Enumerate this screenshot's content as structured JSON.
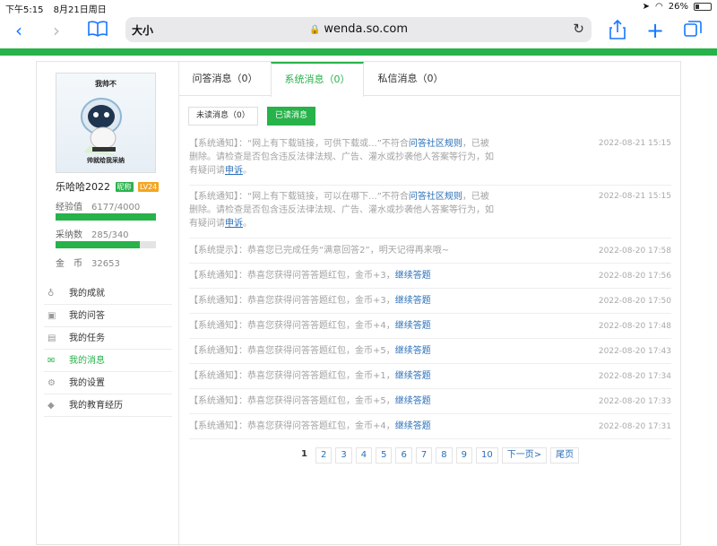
{
  "status_bar": {
    "time": "下午5:15",
    "date": "8月21日周日",
    "battery": "26%",
    "battery_level": 0.26
  },
  "browser": {
    "text_size": "大小",
    "url": "wenda.so.com"
  },
  "profile": {
    "avatar_top_text": "我帅不",
    "avatar_bottom_text": "帅就给我采纳",
    "username": "乐哈哈2022",
    "badge_nick": "昵称",
    "badge_level": "LV24",
    "experience_label": "经验值",
    "experience_value": "6177/4000",
    "experience_fill": 1.0,
    "adoption_label": "采纳数",
    "adoption_value": "285/340",
    "adoption_fill": 0.838,
    "coins_label": "金　币",
    "coins_value": "32653"
  },
  "menu": [
    {
      "label": "我的成就",
      "icon": "medal-icon",
      "active": false
    },
    {
      "label": "我的问答",
      "icon": "question-icon",
      "active": false
    },
    {
      "label": "我的任务",
      "icon": "calendar-icon",
      "active": false
    },
    {
      "label": "我的消息",
      "icon": "mail-icon",
      "active": true
    },
    {
      "label": "我的设置",
      "icon": "gear-icon",
      "active": false
    },
    {
      "label": "我的教育经历",
      "icon": "graduation-cap-icon",
      "active": false
    }
  ],
  "tabs": [
    {
      "label": "问答消息（0）",
      "active": false
    },
    {
      "label": "系统消息（0）",
      "active": true
    },
    {
      "label": "私信消息（0）",
      "active": false
    }
  ],
  "subtabs": {
    "unread": "未读消息（0）",
    "read": "已读消息"
  },
  "messages": [
    {
      "prefix": "【系统通知】：“网上有下载链接，可供下载或...”不符合",
      "link": "问答社区规则",
      "middle": "，已被删除。请检查是否包含违反法律法规、广告、灌水或抄袭他人答案等行为，如有疑问请",
      "link2": "申诉",
      "suffix": "。",
      "time": "2022-08-21 15:15"
    },
    {
      "prefix": "【系统通知】：“网上有下载链接，可以在哪下...”不符合",
      "link": "问答社区规则",
      "middle": "，已被删除。请检查是否包含违反法律法规、广告、灌水或抄袭他人答案等行为，如有疑问请",
      "link2": "申诉",
      "suffix": "。",
      "time": "2022-08-21 15:15"
    },
    {
      "prefix": "【系统提示】：恭喜您已完成任务“满意回答2”，明天记得再来哦~",
      "link": "",
      "time": "2022-08-20 17:58"
    },
    {
      "prefix": "【系统通知】：恭喜您获得问答答题红包，金币+3，",
      "link": "继续答题",
      "time": "2022-08-20 17:56"
    },
    {
      "prefix": "【系统通知】：恭喜您获得问答答题红包，金币+3，",
      "link": "继续答题",
      "time": "2022-08-20 17:50"
    },
    {
      "prefix": "【系统通知】：恭喜您获得问答答题红包，金币+4，",
      "link": "继续答题",
      "time": "2022-08-20 17:48"
    },
    {
      "prefix": "【系统通知】：恭喜您获得问答答题红包，金币+5，",
      "link": "继续答题",
      "time": "2022-08-20 17:43"
    },
    {
      "prefix": "【系统通知】：恭喜您获得问答答题红包，金币+1，",
      "link": "继续答题",
      "time": "2022-08-20 17:34"
    },
    {
      "prefix": "【系统通知】：恭喜您获得问答答题红包，金币+5，",
      "link": "继续答题",
      "time": "2022-08-20 17:33"
    },
    {
      "prefix": "【系统通知】：恭喜您获得问答答题红包，金币+4，",
      "link": "继续答题",
      "time": "2022-08-20 17:31"
    }
  ],
  "pagination": {
    "current": "1",
    "pages": [
      "2",
      "3",
      "4",
      "5",
      "6",
      "7",
      "8",
      "9",
      "10"
    ],
    "next": "下一页>",
    "last": "尾页"
  },
  "colors": {
    "accent": "#27b24a",
    "link": "#2a6fb8",
    "ios_blue": "#1677ff"
  }
}
